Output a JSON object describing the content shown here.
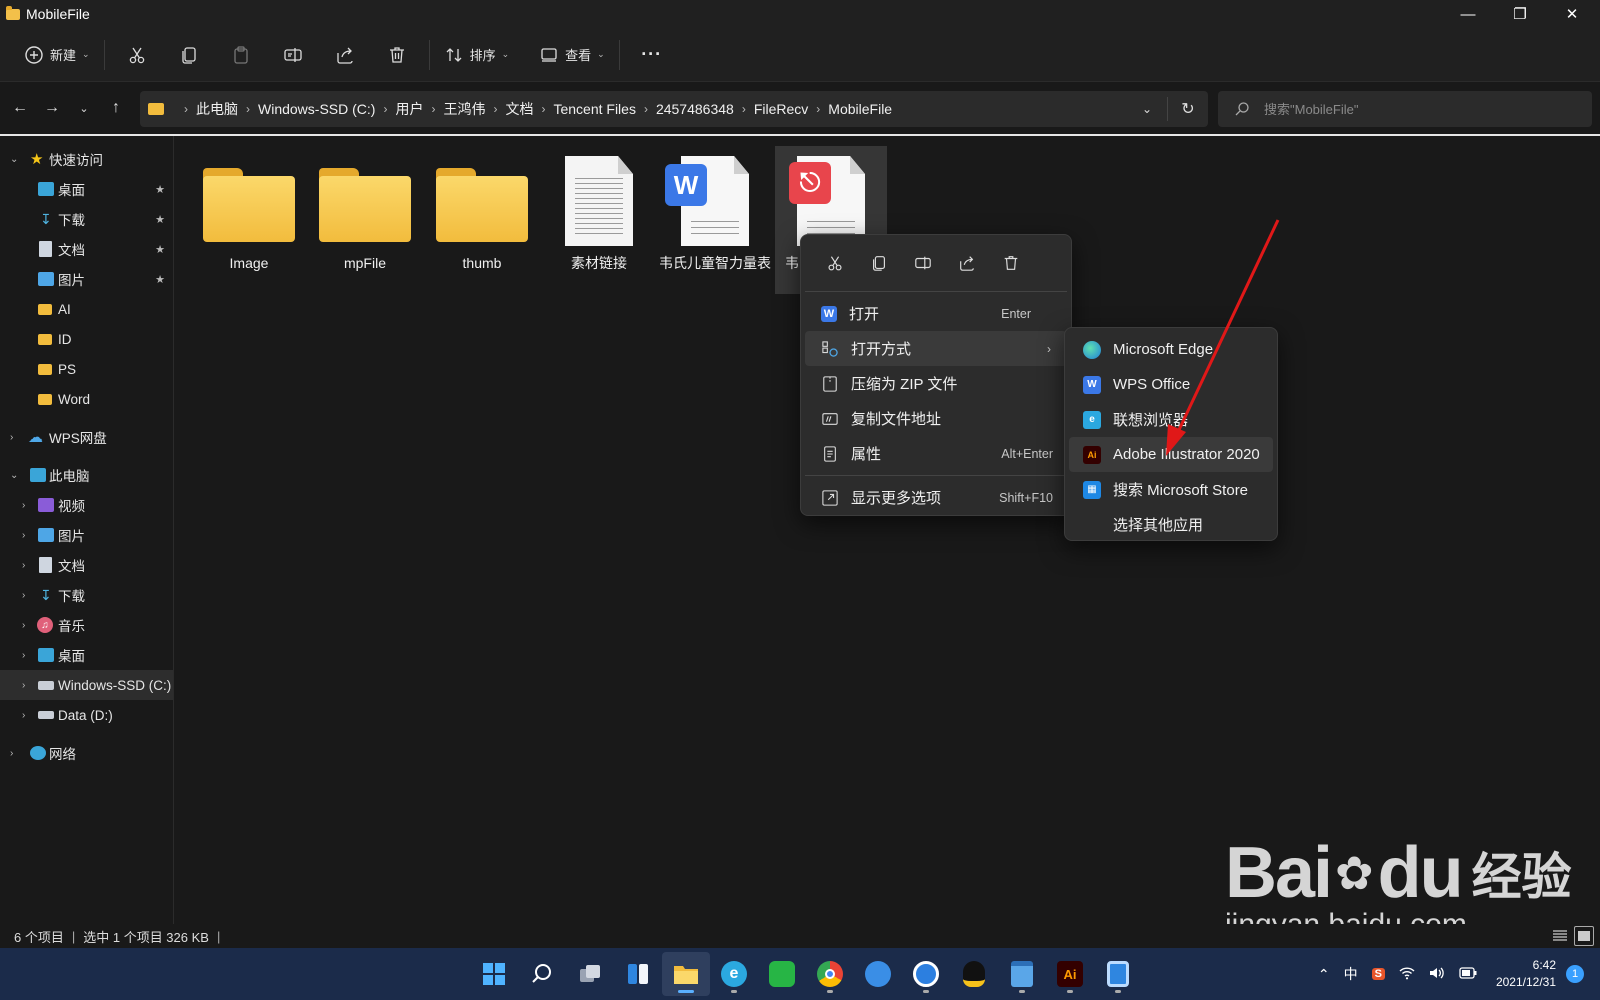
{
  "window": {
    "title": "MobileFile",
    "controls": [
      "minimize",
      "restore",
      "close"
    ]
  },
  "commandbar": {
    "new_label": "新建",
    "sort_label": "排序",
    "view_label": "查看",
    "more_label": "···"
  },
  "address": {
    "crumbs": [
      "此电脑",
      "Windows-SSD (C:)",
      "用户",
      "王鸿伟",
      "文档",
      "Tencent Files",
      "2457486348",
      "FileRecv",
      "MobileFile"
    ],
    "search_placeholder": "搜索\"MobileFile\""
  },
  "sidebar": {
    "quick_access": "快速访问",
    "quick_items": [
      "桌面",
      "下载",
      "文档",
      "图片",
      "AI",
      "ID",
      "PS",
      "Word"
    ],
    "wps": "WPS网盘",
    "this_pc": "此电脑",
    "pc_items": [
      "视频",
      "图片",
      "文档",
      "下载",
      "音乐",
      "桌面",
      "Windows-SSD (C:)",
      "Data (D:)"
    ],
    "network": "网络"
  },
  "files": [
    {
      "name": "Image",
      "type": "folder"
    },
    {
      "name": "mpFile",
      "type": "folder"
    },
    {
      "name": "thumb",
      "type": "folder"
    },
    {
      "name": "素材链接",
      "type": "text"
    },
    {
      "name": "韦氏儿童智力量表",
      "type": "word"
    },
    {
      "name": "韦",
      "type": "pdf"
    }
  ],
  "context_menu": {
    "items": [
      {
        "label": "打开",
        "shortcut": "Enter"
      },
      {
        "label": "打开方式",
        "shortcut": ""
      },
      {
        "label": "压缩为 ZIP 文件",
        "shortcut": ""
      },
      {
        "label": "复制文件地址",
        "shortcut": ""
      },
      {
        "label": "属性",
        "shortcut": "Alt+Enter"
      },
      {
        "label": "显示更多选项",
        "shortcut": "Shift+F10"
      }
    ]
  },
  "open_with": {
    "items": [
      "Microsoft Edge",
      "WPS Office",
      "联想浏览器",
      "Adobe Illustrator 2020",
      "搜索 Microsoft Store",
      "选择其他应用"
    ]
  },
  "status": {
    "count": "6 个项目",
    "selection": "选中 1 个项目  326 KB"
  },
  "taskbar": {
    "ime": "中",
    "time": "6:42",
    "date": "2021/12/31",
    "notifications": "1"
  },
  "watermark": {
    "brand": "Bai",
    "brand2": "du",
    "brand_cn": "经验",
    "url": "jingyan.baidu.com"
  },
  "colors": {
    "accent": "#5ab0ff",
    "folder": "#f2bc3d",
    "word": "#3b78e7",
    "pdf": "#e8454c",
    "illustrator": "#330000",
    "annotation_arrow": "#e01818"
  }
}
